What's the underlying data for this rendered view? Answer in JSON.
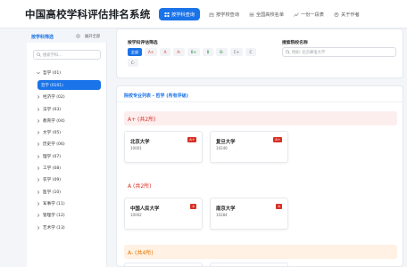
{
  "header": {
    "title": "中国高校学科评估排名系统",
    "nav": [
      {
        "label": "按学科查询",
        "icon": "grid-icon",
        "active": true
      },
      {
        "label": "按学校查询",
        "icon": "building-icon",
        "active": false
      },
      {
        "label": "全国高校名单",
        "icon": "list-icon",
        "active": false
      },
      {
        "label": "一份一段表",
        "icon": "chart-icon",
        "active": false
      },
      {
        "label": "关于作者",
        "icon": "user-icon",
        "active": false
      }
    ]
  },
  "sidebar": {
    "title": "按学科筛选",
    "expand_label": "展开全部",
    "search_placeholder": "搜索学科...",
    "items": [
      {
        "label": "哲学 (01)",
        "expanded": true
      },
      {
        "label": "经济学 (02)"
      },
      {
        "label": "法学 (03)"
      },
      {
        "label": "教育学 (04)"
      },
      {
        "label": "文学 (05)"
      },
      {
        "label": "历史学 (06)"
      },
      {
        "label": "理学 (07)"
      },
      {
        "label": "工学 (08)"
      },
      {
        "label": "农学 (09)"
      },
      {
        "label": "医学 (10)"
      },
      {
        "label": "军事学 (11)"
      },
      {
        "label": "管理学 (12)"
      },
      {
        "label": "艺术学 (13)"
      }
    ],
    "selected_child": "哲学 (0101)"
  },
  "filter": {
    "grade_label": "按学科评估筛选",
    "school_label": "搜索院校名称",
    "school_placeholder": "例如: 北京邮电大学",
    "grades": [
      {
        "label": "全部",
        "style": "sel"
      },
      {
        "label": "A+",
        "style": "c-red"
      },
      {
        "label": "A",
        "style": "c-red"
      },
      {
        "label": "A-",
        "style": "c-red"
      },
      {
        "label": "B+",
        "style": "c-green"
      },
      {
        "label": "B",
        "style": "c-green"
      },
      {
        "label": "B-",
        "style": "c-green"
      },
      {
        "label": "C+",
        "style": "c-gray"
      },
      {
        "label": "C",
        "style": "c-gray"
      },
      {
        "label": "C-",
        "style": "c-gray"
      }
    ]
  },
  "results": {
    "title": "院校专业列表 - 哲学 (所有评级)",
    "groups": [
      {
        "grade": "A+ (共2所)",
        "band": "red",
        "schools": [
          {
            "name": "北京大学",
            "code": "10001",
            "badge": "A+"
          },
          {
            "name": "复旦大学",
            "code": "10246",
            "badge": "A+"
          }
        ]
      },
      {
        "grade": "A (共2所)",
        "band": "white",
        "schools": [
          {
            "name": "中国人民大学",
            "code": "10002",
            "badge": "A"
          },
          {
            "name": "南京大学",
            "code": "10284",
            "badge": "A"
          }
        ]
      },
      {
        "grade": "A- (共4所)",
        "band": "orange",
        "schools": []
      }
    ]
  },
  "colors": {
    "accent": "#1a73e8",
    "grade_red": "#d93025",
    "grade_green": "#1e8e3e",
    "grade_orange": "#e37400"
  }
}
